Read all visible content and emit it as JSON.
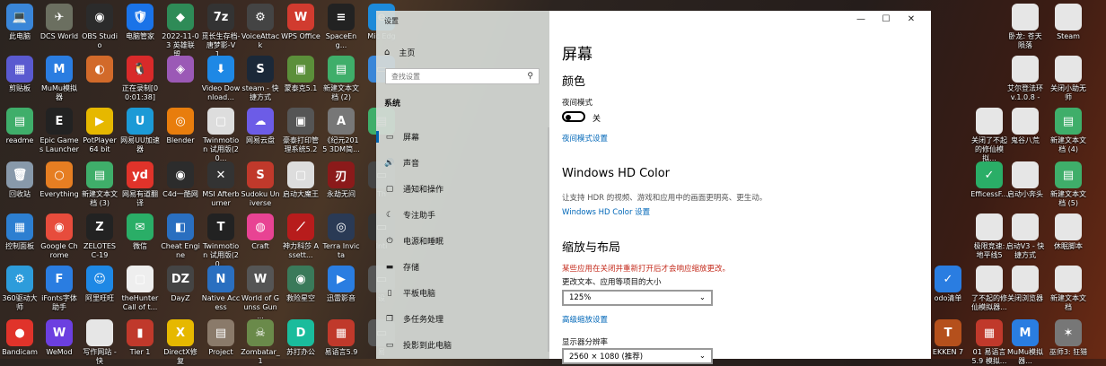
{
  "desktop": {
    "icons": [
      {
        "label": "此电脑",
        "color": "#3a86d8",
        "glyph": "💻"
      },
      {
        "label": "DCS World",
        "color": "#6b6f60",
        "glyph": "✈"
      },
      {
        "label": "OBS Studio",
        "color": "#2b2b2b",
        "glyph": "◉"
      },
      {
        "label": "电脑管家",
        "color": "#1a73e8",
        "glyph": "🛡"
      },
      {
        "label": "2022-11-03 英雄联盟...",
        "color": "#2e8b57",
        "glyph": "◆"
      },
      {
        "label": "觅长生存档-唐梦影-V1...",
        "color": "#333",
        "glyph": "7z"
      },
      {
        "label": "VoiceAttack",
        "color": "#444",
        "glyph": "⚙"
      },
      {
        "label": "WPS Office",
        "color": "#d13b2f",
        "glyph": "W"
      },
      {
        "label": "SpaceEng...",
        "color": "#222",
        "glyph": "≡"
      },
      {
        "label": "Mic Edg",
        "color": "#1d8ad9",
        "glyph": "e"
      },
      {
        "label": "剪贴板",
        "color": "#5a5ad0",
        "glyph": "▦"
      },
      {
        "label": "MuMu模拟器",
        "color": "#2a7de1",
        "glyph": "M"
      },
      {
        "label": "",
        "color": "#d26a2a",
        "glyph": "◐"
      },
      {
        "label": "正在录制[00:01:38]",
        "color": "#d82a2a",
        "glyph": "🐧"
      },
      {
        "label": "",
        "color": "#9b59b6",
        "glyph": "◈"
      },
      {
        "label": "Video Download...",
        "color": "#1e88e5",
        "glyph": "⬇"
      },
      {
        "label": "steam - 快捷方式",
        "color": "#1b2838",
        "glyph": "S"
      },
      {
        "label": "蒙泰克5.1",
        "color": "#5b8f3a",
        "glyph": "▣"
      },
      {
        "label": "新建文本文档 (2)",
        "color": "#3fae6a",
        "glyph": "▤"
      },
      {
        "label": "",
        "color": "#3a86d8",
        "glyph": "▭"
      },
      {
        "label": "readme",
        "color": "#3fae6a",
        "glyph": "▤"
      },
      {
        "label": "Epic Games Launcher",
        "color": "#222",
        "glyph": "E"
      },
      {
        "label": "PotPlayer 64 bit",
        "color": "#e6b800",
        "glyph": "▶"
      },
      {
        "label": "网易UU加速器",
        "color": "#1c9ad6",
        "glyph": "U"
      },
      {
        "label": "Blender",
        "color": "#e87d0d",
        "glyph": "◎"
      },
      {
        "label": "Twinmotion 试用版(20...",
        "color": "#ddd",
        "glyph": "▢"
      },
      {
        "label": "网易云盘",
        "color": "#6c5ce7",
        "glyph": "☁"
      },
      {
        "label": "豪泰打印管理系统5.2",
        "color": "#555",
        "glyph": "▣"
      },
      {
        "label": "《纪元2015 3DM简...",
        "color": "#777",
        "glyph": "A"
      },
      {
        "label": "",
        "color": "#3fae6a",
        "glyph": "▤"
      },
      {
        "label": "回收站",
        "color": "#8899aa",
        "glyph": "🗑"
      },
      {
        "label": "Everything",
        "color": "#e67e22",
        "glyph": "○"
      },
      {
        "label": "新建文本文档 (3)",
        "color": "#3fae6a",
        "glyph": "▤"
      },
      {
        "label": "网易有道翻译",
        "color": "#e0332a",
        "glyph": "yd"
      },
      {
        "label": "C4d一酷网",
        "color": "#2c2c2c",
        "glyph": "◉"
      },
      {
        "label": "MSI Afterburner",
        "color": "#333",
        "glyph": "✕"
      },
      {
        "label": "Sudoku Universe",
        "color": "#c0392b",
        "glyph": "S"
      },
      {
        "label": "启动大魔王",
        "color": "#ddd",
        "glyph": "▢"
      },
      {
        "label": "永劫无间",
        "color": "#8b1a1a",
        "glyph": "刃"
      },
      {
        "label": "Th",
        "color": "#444",
        "glyph": "▭"
      },
      {
        "label": "控制面板",
        "color": "#2d7fd1",
        "glyph": "▦"
      },
      {
        "label": "Google Chrome",
        "color": "#e74c3c",
        "glyph": "◉"
      },
      {
        "label": "ZELOTES C-19",
        "color": "#222",
        "glyph": "Z"
      },
      {
        "label": "微信",
        "color": "#2aae67",
        "glyph": "✉"
      },
      {
        "label": "Cheat Engine",
        "color": "#2a6fc0",
        "glyph": "◧"
      },
      {
        "label": "Twinmotion 试用版(20...",
        "color": "#222",
        "glyph": "T"
      },
      {
        "label": "Craft",
        "color": "#e84393",
        "glyph": "◍"
      },
      {
        "label": "神力科莎 Assett...",
        "color": "#b71c1c",
        "glyph": "⟋"
      },
      {
        "label": "Terra Invicta",
        "color": "#2a3a55",
        "glyph": "◎"
      },
      {
        "label": "Inti",
        "color": "#333",
        "glyph": "▭"
      },
      {
        "label": "360驱动大师",
        "color": "#2d9cdb",
        "glyph": "⚙"
      },
      {
        "label": "iFonts字体助手",
        "color": "#2a7de1",
        "glyph": "F"
      },
      {
        "label": "阿里旺旺",
        "color": "#1e88e5",
        "glyph": "☺"
      },
      {
        "label": "theHunter Call of t...",
        "color": "#eee",
        "glyph": "▢"
      },
      {
        "label": "DayZ",
        "color": "#444",
        "glyph": "DZ"
      },
      {
        "label": "Native Access",
        "color": "#2a6fc0",
        "glyph": "N"
      },
      {
        "label": "World of Gunss Gun ...",
        "color": "#555",
        "glyph": "W"
      },
      {
        "label": "救险星空",
        "color": "#3a7a5a",
        "glyph": "◉"
      },
      {
        "label": "迅雷影音",
        "color": "#2a7de1",
        "glyph": "▶"
      },
      {
        "label": "设",
        "color": "#555",
        "glyph": "▭"
      },
      {
        "label": "Bandicam",
        "color": "#e0332a",
        "glyph": "●"
      },
      {
        "label": "WeMod",
        "color": "#6c3fe0",
        "glyph": "W"
      },
      {
        "label": "写作网站 - 快",
        "color": "#e6e6e6",
        "glyph": ""
      },
      {
        "label": "Tier 1",
        "color": "#c0392b",
        "glyph": "▮"
      },
      {
        "label": "DirectX修复",
        "color": "#e6b800",
        "glyph": "X"
      },
      {
        "label": "Project",
        "color": "#8a7a6a",
        "glyph": "▤"
      },
      {
        "label": "Zombatar_1",
        "color": "#6a8a4a",
        "glyph": "☠"
      },
      {
        "label": "苏打办公",
        "color": "#1abc9c",
        "glyph": "D"
      },
      {
        "label": "易语言5.9",
        "color": "#c0392b",
        "glyph": "▦"
      },
      {
        "label": "易",
        "color": "#555",
        "glyph": "▭"
      }
    ],
    "right_icons": [
      {
        "label": "卧龙: 苍天陨落",
        "color": "#e6e6e6",
        "glyph": ""
      },
      {
        "label": "Steam",
        "color": "#e6e6e6",
        "glyph": ""
      },
      {
        "label": "艾尔登法环 v.1.0.8 -",
        "color": "#e6e6e6",
        "glyph": ""
      },
      {
        "label": "关闭小助无师",
        "color": "#e6e6e6",
        "glyph": ""
      },
      {
        "label": "关闭了不起的修仙模拟...",
        "color": "#e6e6e6",
        "glyph": ""
      },
      {
        "label": "鬼谷八荒",
        "color": "#e6e6e6",
        "glyph": ""
      },
      {
        "label": "新建文本文档 (4)",
        "color": "#3fae6a",
        "glyph": "▤"
      },
      {
        "label": "EfficessF...",
        "color": "#2aae67",
        "glyph": "✓"
      },
      {
        "label": "启动小奔头",
        "color": "#e6e6e6",
        "glyph": ""
      },
      {
        "label": "新建文本文档 (5)",
        "color": "#3fae6a",
        "glyph": "▤"
      },
      {
        "label": "极限竞速: 地平线5",
        "color": "#e6e6e6",
        "glyph": ""
      },
      {
        "label": "启动V3 - 快捷方式",
        "color": "#e6e6e6",
        "glyph": ""
      },
      {
        "label": "休眠脚本",
        "color": "#e6e6e6",
        "glyph": ""
      },
      {
        "label": "odo清单",
        "color": "#2a7de1",
        "glyph": "✓"
      },
      {
        "label": "了不起的修仙模拟器...",
        "color": "#e6e6e6",
        "glyph": ""
      },
      {
        "label": "关闭浏览器",
        "color": "#e6e6e6",
        "glyph": ""
      },
      {
        "label": "新建文本文档",
        "color": "#e6e6e6",
        "glyph": ""
      },
      {
        "label": "EKKEN 7",
        "color": "#b5501c",
        "glyph": "T"
      },
      {
        "label": "01 易语言5.9 模拟...",
        "color": "#c0392b",
        "glyph": "▦"
      },
      {
        "label": "MuMu模拟器...",
        "color": "#2a7de1",
        "glyph": "M"
      },
      {
        "label": "巫师3: 狂猎",
        "color": "#777",
        "glyph": "✶"
      }
    ]
  },
  "settings": {
    "window_title": "设置",
    "home_label": "主页",
    "search_placeholder": "查找设置",
    "section_title": "系统",
    "nav_items": [
      {
        "label": "屏幕",
        "icon": "monitor-icon",
        "glyph": "▭",
        "active": true
      },
      {
        "label": "声音",
        "icon": "speaker-icon",
        "glyph": "🔊",
        "active": false
      },
      {
        "label": "通知和操作",
        "icon": "notification-icon",
        "glyph": "▢",
        "active": false
      },
      {
        "label": "专注助手",
        "icon": "moon-icon",
        "glyph": "☾",
        "active": false
      },
      {
        "label": "电源和睡眠",
        "icon": "power-icon",
        "glyph": "⏻",
        "active": false
      },
      {
        "label": "存储",
        "icon": "storage-icon",
        "glyph": "▬",
        "active": false
      },
      {
        "label": "平板电脑",
        "icon": "tablet-icon",
        "glyph": "▯",
        "active": false
      },
      {
        "label": "多任务处理",
        "icon": "multitask-icon",
        "glyph": "❐",
        "active": false
      },
      {
        "label": "投影到此电脑",
        "icon": "project-icon",
        "glyph": "▭",
        "active": false
      }
    ],
    "window_controls": {
      "minimize": "—",
      "maximize": "☐",
      "close": "✕"
    },
    "content": {
      "title": "屏幕",
      "color_heading": "颜色",
      "night_mode_label": "夜间模式",
      "night_mode_state": "关",
      "night_mode_settings_link": "夜间模式设置",
      "hd_color_heading": "Windows HD Color",
      "hd_color_desc": "让支持 HDR 的视频、游戏和应用中的画面更明亮、更生动。",
      "hd_color_link": "Windows HD Color 设置",
      "scale_heading": "缩放与布局",
      "scale_warning": "某些应用在关闭并重新打开后才会响应缩放更改。",
      "scale_label": "更改文本、应用等项目的大小",
      "scale_value": "125%",
      "advanced_scale_link": "高级缩放设置",
      "resolution_label": "显示器分辨率",
      "resolution_value": "2560 × 1080 (推荐)"
    }
  }
}
